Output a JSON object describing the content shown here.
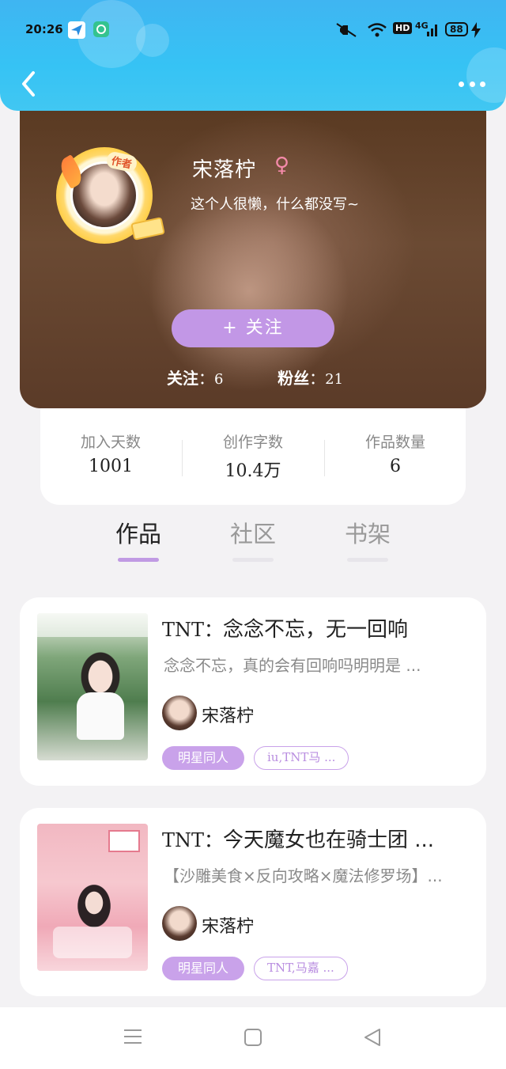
{
  "status_bar": {
    "time": "20:26",
    "network_label": "4G",
    "hd_label": "HD",
    "battery": "88"
  },
  "header": {
    "back_icon": "chevron-left-icon",
    "more_icon": "more-dots-icon"
  },
  "profile": {
    "author_badge": "作者",
    "name": "宋落柠",
    "gender_symbol": "♀",
    "bio": "这个人很懒，什么都没写~",
    "follow_button": "+  关注",
    "following_label": "关注",
    "following_count": "6",
    "fans_label": "粉丝",
    "fans_count": "21"
  },
  "stats": [
    {
      "label": "加入天数",
      "value": "1001"
    },
    {
      "label": "创作字数",
      "value": "10.4万"
    },
    {
      "label": "作品数量",
      "value": "6"
    }
  ],
  "tabs": [
    {
      "label": "作品",
      "active": true
    },
    {
      "label": "社区",
      "active": false
    },
    {
      "label": "书架",
      "active": false
    }
  ],
  "books": [
    {
      "title_prefix": "TNT：",
      "title": "念念不忘，无一回响",
      "description": "念念不忘，真的会有回响吗明明是 ...",
      "author": "宋落柠",
      "tag_primary": "明星同人",
      "tag_secondary": "iu,TNT马 ..."
    },
    {
      "title_prefix": "TNT：",
      "title": "今天魔女也在骑士团 ...",
      "description": "【沙雕美食×反向攻略×魔法修罗场】...",
      "author": "宋落柠",
      "tag_primary": "明星同人",
      "tag_secondary": "TNT,马嘉 ..."
    }
  ],
  "bottom_nav": {
    "menu_icon": "menu-icon",
    "home_icon": "home-square-icon",
    "back_icon": "back-triangle-icon"
  },
  "colors": {
    "header_blue": "#3fb5f2",
    "accent_purple": "#c297e6",
    "gender_pink": "#f48aa9"
  }
}
